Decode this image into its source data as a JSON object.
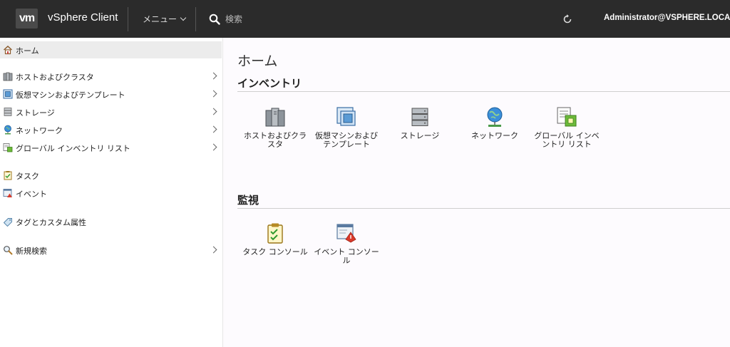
{
  "header": {
    "logo": "vm",
    "app_title": "vSphere Client",
    "menu_label": "メニュー",
    "search_placeholder": "検索",
    "user": "Administrator@VSPHERE.LOCAL"
  },
  "sidebar": {
    "items": [
      {
        "label": "ホーム",
        "icon": "home-icon"
      },
      {
        "label": "ホストおよびクラスタ",
        "icon": "hosts-clusters-icon"
      },
      {
        "label": "仮想マシンおよびテンプレート",
        "icon": "vms-templates-icon"
      },
      {
        "label": "ストレージ",
        "icon": "storage-icon"
      },
      {
        "label": "ネットワーク",
        "icon": "network-icon"
      },
      {
        "label": "グローバル インベントリ リスト",
        "icon": "global-inventory-icon"
      },
      {
        "label": "タスク",
        "icon": "tasks-icon"
      },
      {
        "label": "イベント",
        "icon": "events-icon"
      },
      {
        "label": "タグとカスタム属性",
        "icon": "tags-icon"
      },
      {
        "label": "新規検索",
        "icon": "new-search-icon"
      }
    ]
  },
  "main": {
    "title": "ホーム",
    "inventory": {
      "title": "インベントリ",
      "tiles": [
        {
          "label": "ホストおよびクラスタ",
          "icon": "hosts-clusters-icon"
        },
        {
          "label": "仮想マシンおよびテンプレート",
          "icon": "vms-templates-icon"
        },
        {
          "label": "ストレージ",
          "icon": "storage-icon"
        },
        {
          "label": "ネットワーク",
          "icon": "network-icon"
        },
        {
          "label": "グローバル インベントリ リスト",
          "icon": "global-inventory-icon"
        }
      ]
    },
    "monitoring": {
      "title": "監視",
      "tiles": [
        {
          "label": "タスク コンソール",
          "icon": "task-console-icon"
        },
        {
          "label": "イベント コンソール",
          "icon": "event-console-icon"
        }
      ]
    }
  }
}
